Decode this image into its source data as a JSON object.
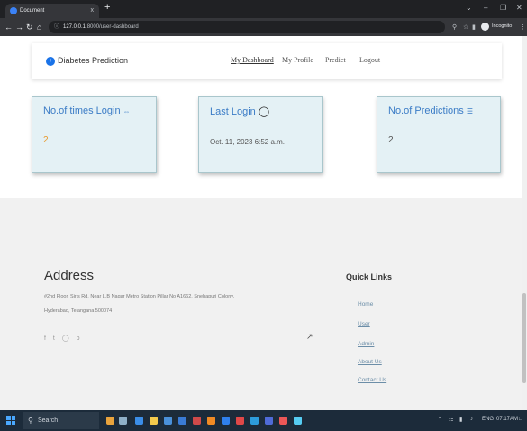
{
  "browser": {
    "tab_title": "Document",
    "tab_close": "x",
    "new_tab": "+",
    "url_host": "127.0.0.1",
    "url_path": ":8000/user-dashboard",
    "profile_label": "Incognito"
  },
  "navbar": {
    "brand": "Diabetes Prediction",
    "links": [
      "My Dashboard",
      "My Profile",
      "Predict",
      "Logout"
    ]
  },
  "cards": [
    {
      "title": "No.of times Login",
      "icon": "login-icon",
      "value": "2"
    },
    {
      "title": "Last Login",
      "icon": "timer-icon",
      "value": "Oct. 11, 2023 6:52 a.m."
    },
    {
      "title": "No.of Predictions",
      "icon": "list-icon",
      "value": "2"
    }
  ],
  "footer": {
    "address_title": "Address",
    "address_line1": "#2nd Floor, Siris Rd, Near L.B Nagar Metro Station Pillar No A1662, Snehapuri Colony,",
    "address_line2": "Hyderabad, Telangana 500074",
    "quick_links_title": "Quick Links",
    "quick_links": [
      "Home",
      "User",
      "Admin",
      "About Us",
      "Contact Us"
    ]
  },
  "taskbar": {
    "search_label": "Search",
    "lang": "ENG",
    "time": "07:17AM"
  },
  "colors": {
    "card_bg": "#e4f1f5",
    "card_title": "#3b7cc6",
    "login_count": "#e89a2c"
  }
}
